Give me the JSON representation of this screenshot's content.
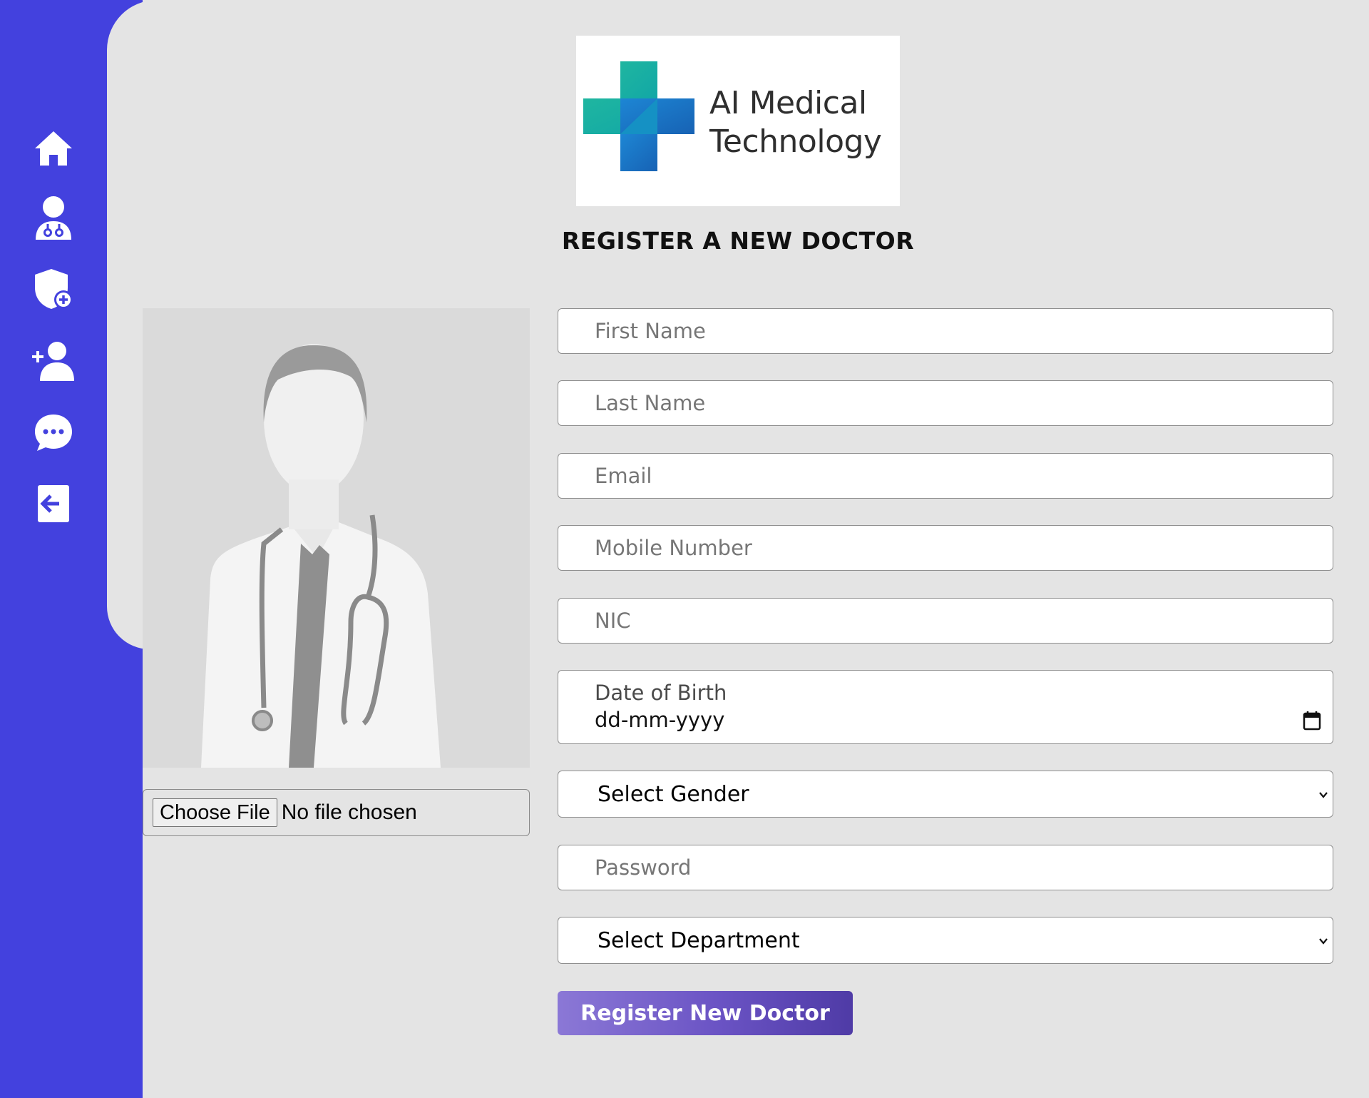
{
  "nav": {
    "items": [
      {
        "icon": "home-icon"
      },
      {
        "icon": "doctor-icon"
      },
      {
        "icon": "shield-plus-icon"
      },
      {
        "icon": "add-user-icon"
      },
      {
        "icon": "chat-icon"
      },
      {
        "icon": "logout-icon"
      }
    ]
  },
  "logo": {
    "text": "AI Medical\nTechnology"
  },
  "page": {
    "title": "REGISTER A NEW DOCTOR"
  },
  "upload": {
    "button_label": "Choose File",
    "status": "No file chosen"
  },
  "form": {
    "first_name_placeholder": "First Name",
    "last_name_placeholder": "Last Name",
    "email_placeholder": "Email",
    "mobile_placeholder": "Mobile Number",
    "nic_placeholder": "NIC",
    "dob_label": "Date of Birth",
    "dob_value": "dd-mm-yyyy",
    "gender_selected": "Select Gender",
    "password_placeholder": "Password",
    "department_selected": "Select Department",
    "submit_label": "Register New Doctor"
  },
  "colors": {
    "sidebar": "#4341de",
    "background": "#e4e4e4",
    "button_start": "#8b78d6",
    "button_end": "#4f3ba6"
  }
}
